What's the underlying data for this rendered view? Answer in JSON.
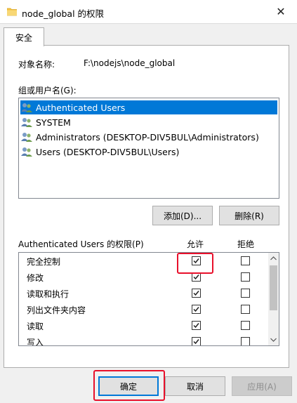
{
  "window": {
    "title": "node_global 的权限",
    "close_glyph": "✕"
  },
  "tabs": [
    {
      "label": "安全"
    }
  ],
  "object": {
    "label": "对象名称:",
    "value": "F:\\nodejs\\node_global"
  },
  "groups": {
    "label": "组或用户名(G):",
    "items": [
      {
        "name": "Authenticated Users",
        "selected": true
      },
      {
        "name": "SYSTEM",
        "selected": false
      },
      {
        "name": "Administrators (DESKTOP-DIV5BUL\\Administrators)",
        "selected": false
      },
      {
        "name": "Users (DESKTOP-DIV5BUL\\Users)",
        "selected": false
      }
    ],
    "add_label": "添加(D)...",
    "remove_label": "删除(R)"
  },
  "permissions": {
    "header": "Authenticated Users 的权限(P)",
    "allow_label": "允许",
    "deny_label": "拒绝",
    "items": [
      {
        "name": "完全控制",
        "allow": true,
        "deny": false
      },
      {
        "name": "修改",
        "allow": true,
        "deny": false
      },
      {
        "name": "读取和执行",
        "allow": true,
        "deny": false
      },
      {
        "name": "列出文件夹内容",
        "allow": true,
        "deny": false
      },
      {
        "name": "读取",
        "allow": true,
        "deny": false
      },
      {
        "name": "写入",
        "allow": true,
        "deny": false
      }
    ]
  },
  "footer": {
    "ok_label": "确定",
    "cancel_label": "取消",
    "apply_label": "应用(A)"
  },
  "colors": {
    "selection": "#0078d7",
    "highlight": "#e8102b",
    "folder": "#f5c242"
  }
}
